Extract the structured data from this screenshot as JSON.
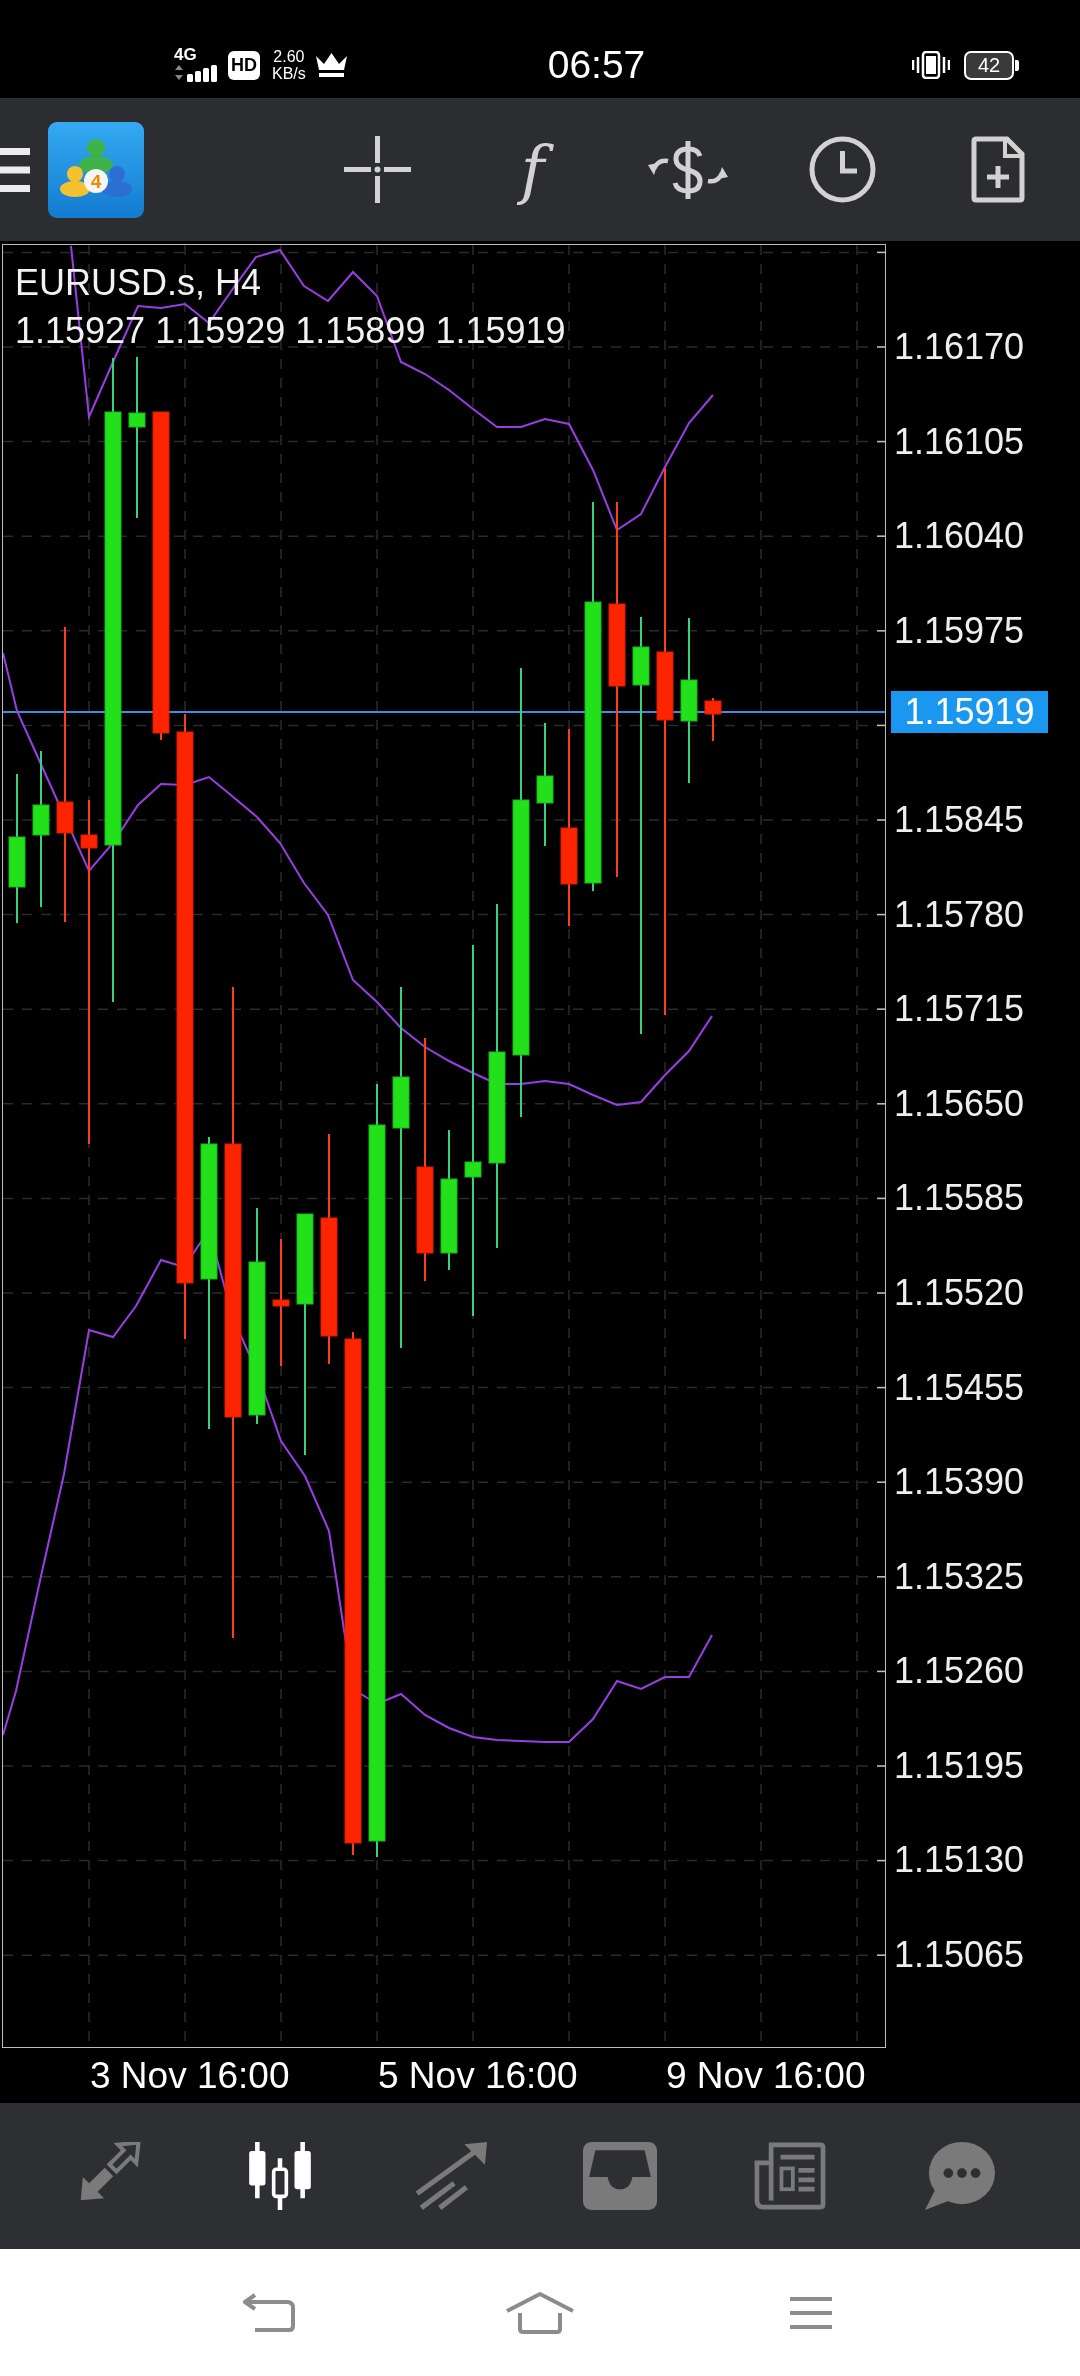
{
  "status_bar": {
    "network": "4G",
    "hd": "HD",
    "speed_value": "2.60",
    "speed_unit": "KB/s",
    "time": "06:57",
    "battery": "42"
  },
  "toolbar": {
    "logo_digit": "4",
    "indicators_label": "f"
  },
  "chart": {
    "title": "EURUSD.s, H4",
    "ohlc": "1.15927 1.15929 1.15899 1.15919",
    "price_labels": [
      "1.16170",
      "1.16105",
      "1.16040",
      "1.15975",
      "1.15845",
      "1.15780",
      "1.15715",
      "1.15650",
      "1.15585",
      "1.15520",
      "1.15455",
      "1.15390",
      "1.15325",
      "1.15260",
      "1.15195",
      "1.15130",
      "1.15065"
    ],
    "current_price": "1.15919",
    "time_labels": [
      "3 Nov 16:00",
      "5 Nov 16:00",
      "9 Nov 16:00"
    ]
  },
  "bottom_nav": [
    {
      "selected": false
    },
    {
      "selected": true
    },
    {
      "selected": false
    },
    {
      "selected": false
    },
    {
      "selected": false
    },
    {
      "selected": false
    }
  ]
}
